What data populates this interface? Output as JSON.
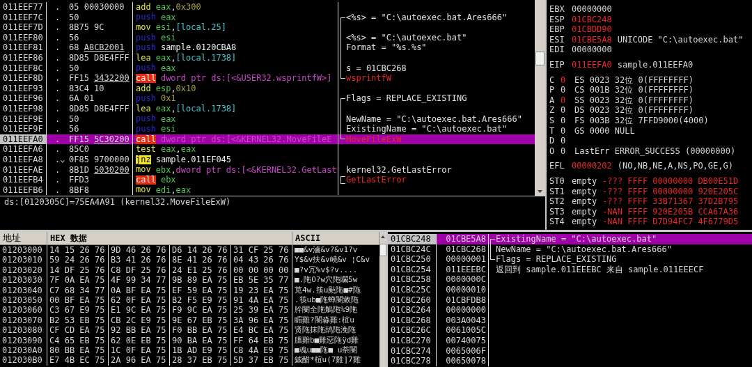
{
  "disassembly": {
    "rows": [
      {
        "address": "011EEF77",
        "marker": ".",
        "jump": false,
        "opcode": "05 00030000",
        "mnemonic": {
          "text": "add",
          "kind": "op"
        },
        "operand": [
          {
            "text": "eax",
            "kind": "reg"
          },
          {
            "text": ",",
            "kind": "plain"
          },
          {
            "text": "0x300",
            "kind": "num"
          }
        ],
        "selected": false
      },
      {
        "address": "011EEF7C",
        "marker": ".",
        "jump": false,
        "opcode": "50",
        "mnemonic": {
          "text": "push",
          "kind": "push"
        },
        "operand": [
          {
            "text": "eax",
            "kind": "reg"
          }
        ],
        "comment": {
          "text": "<%s> = \"C:\\autoexec.bat.Ares666\"",
          "kind": "arg"
        },
        "bracket": {
          "kind": "start"
        },
        "selected": false
      },
      {
        "address": "011EEF7D",
        "marker": ".",
        "jump": false,
        "opcode": "8B75 9C",
        "mnemonic": {
          "text": "mov",
          "kind": "op"
        },
        "operand": [
          {
            "text": "esi",
            "kind": "reg"
          },
          {
            "text": ",",
            "kind": "plain"
          },
          {
            "text": "[local.25]",
            "kind": "mem"
          }
        ],
        "bracket": {
          "kind": "mid"
        },
        "selected": false
      },
      {
        "address": "011EEF80",
        "marker": ".",
        "jump": false,
        "opcode": "56",
        "mnemonic": {
          "text": "push",
          "kind": "push"
        },
        "operand": [
          {
            "text": "esi",
            "kind": "reg"
          }
        ],
        "comment": {
          "text": "<%s> = \"C:\\autoexec.bat\"",
          "kind": "arg"
        },
        "bracket": {
          "kind": "mid"
        },
        "selected": false
      },
      {
        "address": "011EEF81",
        "marker": ".",
        "jump": false,
        "opcode": "68",
        "fixup": "A8CB2001",
        "mnemonic": {
          "text": "push",
          "kind": "push"
        },
        "operand": [
          {
            "text": "sample.0120CBA8",
            "kind": "sym"
          }
        ],
        "comment": {
          "text": "Format = \"%s.%s\"",
          "kind": "arg"
        },
        "bracket": {
          "kind": "mid"
        },
        "selected": false
      },
      {
        "address": "011EEF86",
        "marker": ".",
        "jump": false,
        "opcode": "8D85 D8E4FFF",
        "mnemonic": {
          "text": "lea",
          "kind": "op"
        },
        "operand": [
          {
            "text": "eax",
            "kind": "reg"
          },
          {
            "text": ",",
            "kind": "plain"
          },
          {
            "text": "[local.1738]",
            "kind": "mem"
          }
        ],
        "bracket": {
          "kind": "mid"
        },
        "selected": false
      },
      {
        "address": "011EEF8C",
        "marker": ".",
        "jump": false,
        "opcode": "50",
        "mnemonic": {
          "text": "push",
          "kind": "push"
        },
        "operand": [
          {
            "text": "eax",
            "kind": "reg"
          }
        ],
        "comment": {
          "text": "s = 01CBC268",
          "kind": "arg"
        },
        "bracket": {
          "kind": "mid"
        },
        "selected": false
      },
      {
        "address": "011EEF8D",
        "marker": ".",
        "jump": false,
        "opcode": "FF15",
        "fixup": "3432200",
        "mnemonic": {
          "text": "call",
          "kind": "call"
        },
        "operand": [
          {
            "text": "dword ptr ds:[<&USER32.wsprintfW>]",
            "kind": "api"
          }
        ],
        "comment": {
          "text": "wsprintfW",
          "kind": "api"
        },
        "bracket": {
          "kind": "end"
        },
        "selected": false
      },
      {
        "address": "011EEF93",
        "marker": ".",
        "jump": false,
        "opcode": "83C4 10",
        "mnemonic": {
          "text": "add",
          "kind": "op"
        },
        "operand": [
          {
            "text": "esp",
            "kind": "reg"
          },
          {
            "text": ",",
            "kind": "plain"
          },
          {
            "text": "0x10",
            "kind": "num"
          }
        ],
        "selected": false
      },
      {
        "address": "011EEF96",
        "marker": ".",
        "jump": false,
        "opcode": "6A 01",
        "mnemonic": {
          "text": "push",
          "kind": "push"
        },
        "operand": [
          {
            "text": "0x1",
            "kind": "num"
          }
        ],
        "comment": {
          "text": "Flags = REPLACE_EXISTING",
          "kind": "arg"
        },
        "bracket": {
          "kind": "start"
        },
        "selected": false
      },
      {
        "address": "011EEF98",
        "marker": ".",
        "jump": false,
        "opcode": "8D85 D8E4FFF",
        "mnemonic": {
          "text": "lea",
          "kind": "op"
        },
        "operand": [
          {
            "text": "eax",
            "kind": "reg"
          },
          {
            "text": ",",
            "kind": "plain"
          },
          {
            "text": "[local.1738]",
            "kind": "mem"
          }
        ],
        "bracket": {
          "kind": "mid"
        },
        "selected": false
      },
      {
        "address": "011EEF9E",
        "marker": ".",
        "jump": false,
        "opcode": "50",
        "mnemonic": {
          "text": "push",
          "kind": "push"
        },
        "operand": [
          {
            "text": "eax",
            "kind": "reg"
          }
        ],
        "comment": {
          "text": "NewName = \"C:\\autoexec.bat.Ares666\"",
          "kind": "arg"
        },
        "bracket": {
          "kind": "mid"
        },
        "selected": false
      },
      {
        "address": "011EEF9F",
        "marker": ".",
        "jump": false,
        "opcode": "56",
        "mnemonic": {
          "text": "push",
          "kind": "push"
        },
        "operand": [
          {
            "text": "esi",
            "kind": "reg"
          }
        ],
        "comment": {
          "text": "ExistingName = \"C:\\autoexec.bat\"",
          "kind": "arg"
        },
        "bracket": {
          "kind": "mid"
        },
        "selected": false
      },
      {
        "address": "011EEFA0",
        "marker": ".",
        "jump": false,
        "opcode": "FF15",
        "fixup": "5C30200",
        "mnemonic": {
          "text": "call",
          "kind": "call"
        },
        "operand": [
          {
            "text": "dword ptr ds:[<&KERNEL32.MoveFileE",
            "kind": "api"
          }
        ],
        "comment": {
          "text": "MoveFileExW",
          "kind": "api"
        },
        "bracket": {
          "kind": "end"
        },
        "selected": true
      },
      {
        "address": "011EEFA6",
        "marker": ".",
        "jump": false,
        "opcode": "85C0",
        "mnemonic": {
          "text": "test",
          "kind": "op"
        },
        "operand": [
          {
            "text": "eax",
            "kind": "reg"
          },
          {
            "text": ",",
            "kind": "plain"
          },
          {
            "text": "eax",
            "kind": "reg"
          }
        ],
        "selected": false
      },
      {
        "address": "011EEFA8",
        "marker": ".",
        "jump": true,
        "opcode": "0F85 9700000",
        "mnemonic": {
          "text": "jnz",
          "kind": "jump"
        },
        "operand": [
          {
            "text": "sample.011EF045",
            "kind": "sym"
          }
        ],
        "selected": false
      },
      {
        "address": "011EEFAE",
        "marker": ".",
        "jump": false,
        "opcode": "8B1D",
        "fixup": "5030200",
        "mnemonic": {
          "text": "mov",
          "kind": "op"
        },
        "operand": [
          {
            "text": "ebx",
            "kind": "reg"
          },
          {
            "text": ",",
            "kind": "plain"
          },
          {
            "text": "dword ptr ds:[<&KERNEL32.GetLast",
            "kind": "api"
          }
        ],
        "comment": {
          "text": "kernel32.GetLastError",
          "kind": "arg"
        },
        "selected": false
      },
      {
        "address": "011EEFB4",
        "marker": ".",
        "jump": false,
        "opcode": "FFD3",
        "mnemonic": {
          "text": "call",
          "kind": "call"
        },
        "operand": [
          {
            "text": "ebx",
            "kind": "reg"
          }
        ],
        "comment": {
          "text": "GetLastError",
          "kind": "api"
        },
        "bracket": {
          "kind": "single"
        },
        "selected": false
      },
      {
        "address": "011EEFB6",
        "marker": ".",
        "jump": false,
        "opcode": "8BF8",
        "mnemonic": {
          "text": "mov",
          "kind": "op"
        },
        "operand": [
          {
            "text": "edi",
            "kind": "reg"
          },
          {
            "text": ",",
            "kind": "plain"
          },
          {
            "text": "eax",
            "kind": "reg"
          }
        ],
        "selected": false
      }
    ],
    "info_line": "ds:[0120305C]=75EA4A91 (kernel32.MoveFileExW)"
  },
  "registers": {
    "general": [
      {
        "name": "EBX",
        "value": "00000000",
        "changed": false
      },
      {
        "name": "ESP",
        "value": "01CBC248",
        "changed": true
      },
      {
        "name": "EBP",
        "value": "01CBDD90",
        "changed": true
      },
      {
        "name": "ESI",
        "value": "01CBE5A8",
        "changed": true,
        "comment": "UNICODE \"C:\\autoexec.bat\""
      },
      {
        "name": "EDI",
        "value": "00000000",
        "changed": false
      }
    ],
    "eip": [
      {
        "name": "EIP",
        "value": "011EEFA0",
        "changed": true,
        "comment": "sample.011EEFA0"
      }
    ],
    "flags": [
      {
        "flag": "C",
        "bit": "0",
        "changed": true,
        "info": "ES 0023 32位 0(FFFFFFFF)"
      },
      {
        "flag": "P",
        "bit": "0",
        "changed": false,
        "info": "CS 001B 32位 0(FFFFFFFF)"
      },
      {
        "flag": "A",
        "bit": "0",
        "changed": true,
        "info": "SS 0023 32位 0(FFFFFFFF)"
      },
      {
        "flag": "Z",
        "bit": "0",
        "changed": false,
        "info": "DS 0023 32位 0(FFFFFFFF)"
      },
      {
        "flag": "S",
        "bit": "0",
        "changed": false,
        "info": "FS 003B 32位 7FFD9000(4000)"
      },
      {
        "flag": "T",
        "bit": "0",
        "changed": false,
        "info": "GS 0000 NULL"
      },
      {
        "flag": "D",
        "bit": "0",
        "changed": false
      },
      {
        "flag": "O",
        "bit": "0",
        "changed": false,
        "info": "LastErr ERROR_SUCCESS (00000000)"
      }
    ],
    "efl": [
      {
        "name": "EFL",
        "value": "00000202",
        "changed": true,
        "comment": "(NO,NB,NE,A,NS,PO,GE,G)"
      }
    ],
    "fpu": [
      {
        "name": "ST0",
        "tag": "empty",
        "value": "-??? FFFF 00000000 DB00E51D"
      },
      {
        "name": "ST1",
        "tag": "empty",
        "value": "-??? FFFF 00000000 920E205C"
      },
      {
        "name": "ST2",
        "tag": "empty",
        "value": "-??? FFFF 33B71367 37D2B795"
      },
      {
        "name": "ST3",
        "tag": "empty",
        "value": "-NAN FFFF 920E205B CCA67A36"
      },
      {
        "name": "ST4",
        "tag": "empty",
        "value": "-NAN FFFF D7D94FC7 4F6779D5"
      }
    ]
  },
  "dump": {
    "columns": [
      "地址",
      "HEX 数据",
      "ASCII"
    ],
    "rows": [
      {
        "address": "01203000",
        "hex": [
          "14 15 26 76",
          "9D 46 26 76",
          "D6 14 26 76",
          "31 CF 25 76"
        ],
        "ascii": "■■&v滷&v?&v1?v"
      },
      {
        "address": "01203010",
        "hex": [
          "59 24 26 76",
          "B3 41 26 76",
          "8E 41 26 76",
          "04 43 26 76"
        ],
        "ascii": "Y$&v扶&v嶢&v ¦C&v"
      },
      {
        "address": "01203020",
        "hex": [
          "14 DF 25 76",
          "C8 DF 25 76",
          "24 E1 25 76",
          "00 00 00 00"
        ],
        "ascii": "■?v冗%v$?v...."
      },
      {
        "address": "01203030",
        "hex": [
          "7F 0A EA 75",
          "4F 99 34 77",
          "9B 89 EA 75",
          "EB 5E 35 77"
        ],
        "ascii": "■.陁O?w穴陁矙5w"
      },
      {
        "address": "01203040",
        "hex": [
          "C7 68 34 77",
          "0A BF EA 75",
          "EF 59 EA 75",
          "19 23 EA 75"
        ],
        "ascii": "苋4w.筷u颭陁■#陁"
      },
      {
        "address": "01203050",
        "hex": [
          "00 BF EA 75",
          "62 0F EA 75",
          "B2 F5 E9 75",
          "91 4A EA 75"
        ],
        "ascii": ".筷ub■陁蝉閿敹陁"
      },
      {
        "address": "01203060",
        "hex": [
          "C3 67 E9 75",
          "E1 9C EA 75",
          "F9 9C EA 75",
          "25 39 EA 75"
        ],
        "ascii": "肸閿全陁鵤陁%9陁"
      },
      {
        "address": "01203070",
        "hex": [
          "B2 53 EB 75",
          "CB 2C E9 75",
          "9E 67 EB 75",
          "3A 96 EA 75"
        ],
        "ascii": "睸雞?閿淼雞:椬u"
      },
      {
        "address": "01203080",
        "hex": [
          "CF CD EA 75",
          "92 BB EA 75",
          "F0 BB EA 75",
          "E4 BC EA 75"
        ],
        "ascii": "贤陁抹陁鸹陁浼陁"
      },
      {
        "address": "01203090",
        "hex": [
          "C4 65 EB 75",
          "62 0E EB 75",
          "90 BA EA 75",
          "FF 64 EB 75"
        ],
        "ascii": "膃雞b■雞惡陁ÿd雞"
      },
      {
        "address": "012030A0",
        "hex": [
          "80 BB EA 75",
          "1C 0F EA 75",
          "1B AD E9 75",
          "C8 4A E9 75"
        ],
        "ascii": "■魂u■■陁■ u荼閿"
      },
      {
        "address": "012030B0",
        "hex": [
          "E7 4B EC 75",
          "2A 96 EA 75",
          "28 37 EB 75",
          "5D 37 EB 75"
        ],
        "ascii": "鋮醋*椬u(7雞]7雞"
      }
    ]
  },
  "stack": {
    "rows": [
      {
        "address": "01CBC248",
        "value": "01CBE5A8",
        "comment": "ExistingName = \"C:\\autoexec.bat\"",
        "bracket": {
          "kind": "start"
        },
        "selected": true
      },
      {
        "address": "01CBC24C",
        "value": "01CBC268",
        "comment": "NewName = \"C:\\autoexec.bat.Ares666\"",
        "bracket": {
          "kind": "mid"
        },
        "selected": false
      },
      {
        "address": "01CBC250",
        "value": "00000001",
        "comment": "Flags = REPLACE_EXISTING",
        "bracket": {
          "kind": "end"
        },
        "selected": false
      },
      {
        "address": "01CBC254",
        "value": "011EEEBC",
        "comment": "返回到 sample.011EEEBC 来自 sample.011EEECF",
        "selected": false
      },
      {
        "address": "01CBC258",
        "value": "0000000C",
        "selected": false
      },
      {
        "address": "01CBC25C",
        "value": "00000010",
        "selected": false
      },
      {
        "address": "01CBC260",
        "value": "01CBFDB8",
        "selected": false
      },
      {
        "address": "01CBC264",
        "value": "00000000",
        "selected": false
      },
      {
        "address": "01CBC268",
        "value": "003A0043",
        "selected": false
      },
      {
        "address": "01CBC26C",
        "value": "0061005C",
        "selected": false
      },
      {
        "address": "01CBC270",
        "value": "00740075",
        "selected": false
      },
      {
        "address": "01CBC274",
        "value": "0065006F",
        "selected": false
      },
      {
        "address": "01CBC278",
        "value": "00650078",
        "selected": false
      }
    ]
  }
}
